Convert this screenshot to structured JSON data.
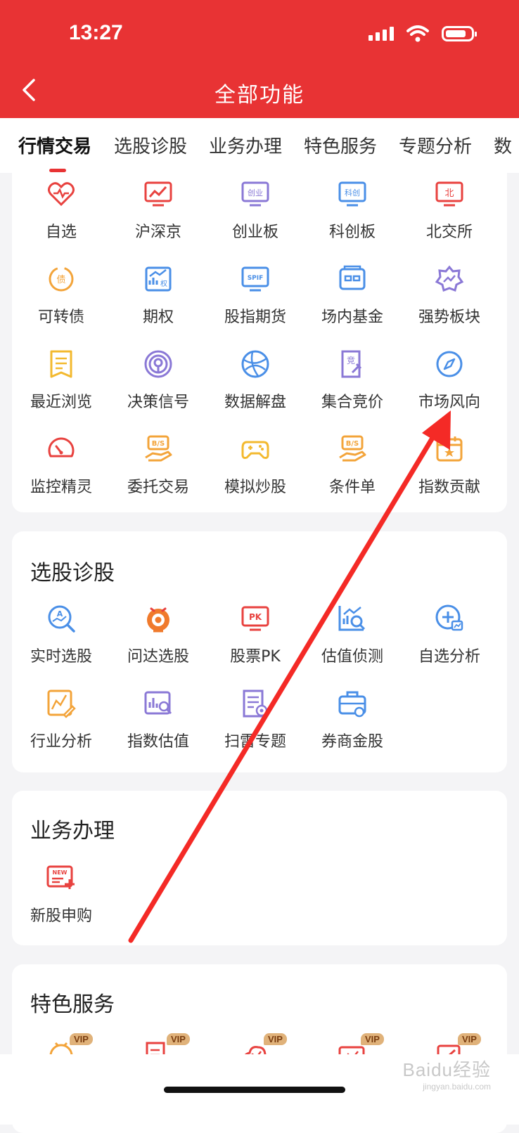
{
  "status_bar": {
    "time": "13:27"
  },
  "header": {
    "title": "全部功能"
  },
  "tabs": [
    "行情交易",
    "选股诊股",
    "业务办理",
    "特色服务",
    "专题分析",
    "数"
  ],
  "sections": {
    "market": {
      "items": [
        {
          "label": "自选",
          "icon": "heart-icon"
        },
        {
          "label": "沪深京",
          "icon": "trend-monitor-icon"
        },
        {
          "label": "创业板",
          "icon": "chuangye-icon",
          "icon_text": "创业"
        },
        {
          "label": "科创板",
          "icon": "kechuang-icon",
          "icon_text": "科创"
        },
        {
          "label": "北交所",
          "icon": "beijing-exchange-icon",
          "icon_text": "北"
        },
        {
          "label": "可转债",
          "icon": "bond-icon",
          "icon_text": "债"
        },
        {
          "label": "期权",
          "icon": "options-icon",
          "icon_text": "权"
        },
        {
          "label": "股指期货",
          "icon": "spif-icon",
          "icon_text": "SPIF"
        },
        {
          "label": "场内基金",
          "icon": "fund-icon"
        },
        {
          "label": "强势板块",
          "icon": "strong-sector-icon"
        },
        {
          "label": "最近浏览",
          "icon": "document-icon"
        },
        {
          "label": "决策信号",
          "icon": "signal-icon"
        },
        {
          "label": "数据解盘",
          "icon": "globe-icon"
        },
        {
          "label": "集合竞价",
          "icon": "auction-icon",
          "icon_text": "竞"
        },
        {
          "label": "市场风向",
          "icon": "compass-icon"
        },
        {
          "label": "监控精灵",
          "icon": "gauge-icon"
        },
        {
          "label": "委托交易",
          "icon": "bs-hand-icon",
          "icon_text": "B/S"
        },
        {
          "label": "模拟炒股",
          "icon": "gamepad-icon"
        },
        {
          "label": "条件单",
          "icon": "bs-hand-icon",
          "icon_text": "B/S"
        },
        {
          "label": "指数贡献",
          "icon": "calendar-star-icon"
        }
      ]
    },
    "stock_pick": {
      "title": "选股诊股",
      "items": [
        {
          "label": "实时选股",
          "icon": "search-chart-icon",
          "icon_text": "A"
        },
        {
          "label": "问达选股",
          "icon": "robot-icon"
        },
        {
          "label": "股票PK",
          "icon": "pk-icon",
          "icon_text": "PK"
        },
        {
          "label": "估值侦测",
          "icon": "valuation-icon"
        },
        {
          "label": "自选分析",
          "icon": "add-analysis-icon"
        },
        {
          "label": "行业分析",
          "icon": "industry-icon"
        },
        {
          "label": "指数估值",
          "icon": "index-valuation-icon"
        },
        {
          "label": "扫雷专题",
          "icon": "mine-sweep-icon"
        },
        {
          "label": "券商金股",
          "icon": "briefcase-icon"
        }
      ]
    },
    "business": {
      "title": "业务办理",
      "items": [
        {
          "label": "新股申购",
          "icon": "new-ipo-icon",
          "icon_text": "NEW"
        }
      ]
    },
    "special": {
      "title": "特色服务",
      "badge": "VIP",
      "items": [
        {
          "icon": "vip-1-icon"
        },
        {
          "icon": "vip-2-icon"
        },
        {
          "icon": "vip-3-icon"
        },
        {
          "icon": "vip-4-icon"
        },
        {
          "icon": "vip-5-icon"
        }
      ]
    }
  },
  "watermark": {
    "brand": "Baidu经验",
    "url": "jingyan.baidu.com"
  },
  "colors": {
    "header": "#e83334",
    "accent_red": "#e8423f",
    "blue": "#4a8fe7",
    "purple": "#8a78d6",
    "orange": "#f3a43a",
    "arrow": "#f42a26"
  }
}
